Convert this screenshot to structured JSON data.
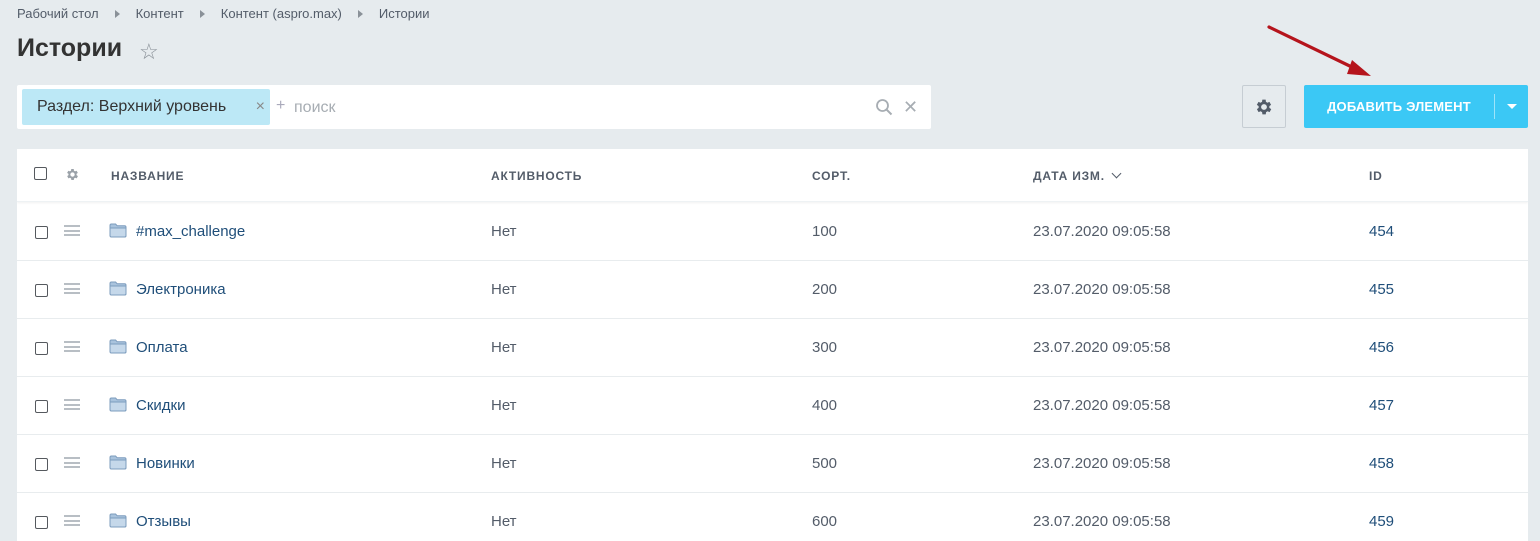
{
  "breadcrumb": [
    "Рабочий стол",
    "Контент",
    "Контент (aspro.max)",
    "Истории"
  ],
  "page": {
    "title": "Истории"
  },
  "filter": {
    "tag_label": "Раздел: Верхний уровень",
    "search_prefix": "+",
    "search_placeholder": "поиск"
  },
  "toolbar": {
    "add_label": "ДОБАВИТЬ ЭЛЕМЕНТ"
  },
  "table": {
    "headers": {
      "name": "НАЗВАНИЕ",
      "active": "АКТИВНОСТЬ",
      "sort": "СОРТ.",
      "date": "ДАТА ИЗМ.",
      "id": "ID"
    },
    "rows": [
      {
        "name": "#max_challenge",
        "active": "Нет",
        "sort": "100",
        "date": "23.07.2020 09:05:58",
        "id": "454"
      },
      {
        "name": "Электроника",
        "active": "Нет",
        "sort": "200",
        "date": "23.07.2020 09:05:58",
        "id": "455"
      },
      {
        "name": "Оплата",
        "active": "Нет",
        "sort": "300",
        "date": "23.07.2020 09:05:58",
        "id": "456"
      },
      {
        "name": "Скидки",
        "active": "Нет",
        "sort": "400",
        "date": "23.07.2020 09:05:58",
        "id": "457"
      },
      {
        "name": "Новинки",
        "active": "Нет",
        "sort": "500",
        "date": "23.07.2020 09:05:58",
        "id": "458"
      },
      {
        "name": "Отзывы",
        "active": "Нет",
        "sort": "600",
        "date": "23.07.2020 09:05:58",
        "id": "459"
      }
    ]
  },
  "colors": {
    "accent": "#3bc8f5",
    "tag_bg": "#bce8f6",
    "annotation_arrow": "#b5141c",
    "page_bg": "#e6ebee"
  }
}
